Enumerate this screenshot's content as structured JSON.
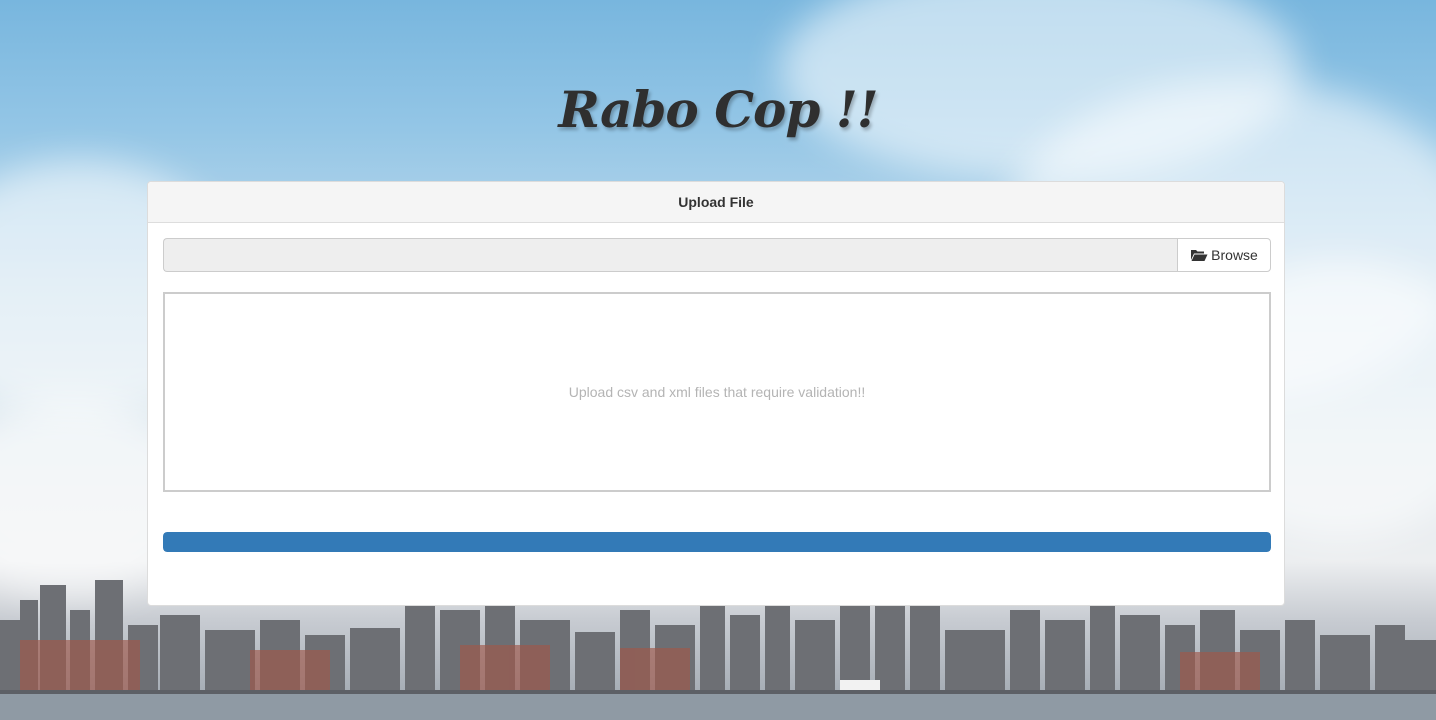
{
  "app": {
    "title": "Rabo Cop !!"
  },
  "panel": {
    "heading": "Upload File",
    "browse_label": "Browse",
    "browse_icon": "folder-open-icon",
    "file_input_value": "",
    "drop_zone_text": "Upload csv and xml files that require validation!!",
    "progress_fraction": 1.0
  },
  "colors": {
    "progress_bar": "#337ab7",
    "title": "#2f2f2f"
  }
}
